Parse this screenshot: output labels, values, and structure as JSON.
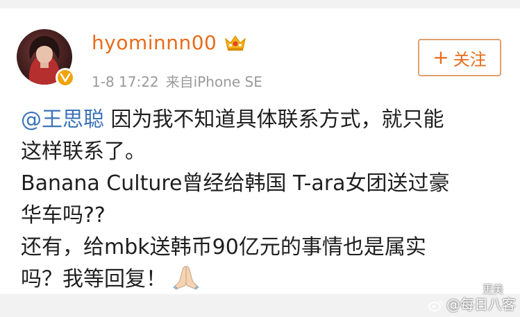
{
  "post": {
    "username": "hyominnn00",
    "time": "1-8 17:22",
    "source": "来自iPhone SE",
    "follow_label": "关注",
    "mention": "@王思聪",
    "line1_rest": " 因为我不知道具体联系方式，就只能",
    "line2": "这样联系了。",
    "line3": "Banana Culture曾经给韩国 T-ara女团送过豪",
    "line4": "华车吗??",
    "line5": "还有，给mbk送韩币90亿元的事情也是属实",
    "line6": "吗？我等回复！"
  },
  "watermark": {
    "top": "更美",
    "bottom": "@每日八客"
  },
  "icons": {
    "crown": "vip-crown-icon",
    "verified": "verified-badge-icon",
    "pray": "praying-hands-icon",
    "weibo": "weibo-logo-icon",
    "plus": "plus-icon"
  },
  "colors": {
    "username": "#e86b1a",
    "mention": "#3b73b8",
    "meta": "#9a9a9a",
    "badge": "#f0a30a",
    "follow_border": "#e0a070"
  }
}
